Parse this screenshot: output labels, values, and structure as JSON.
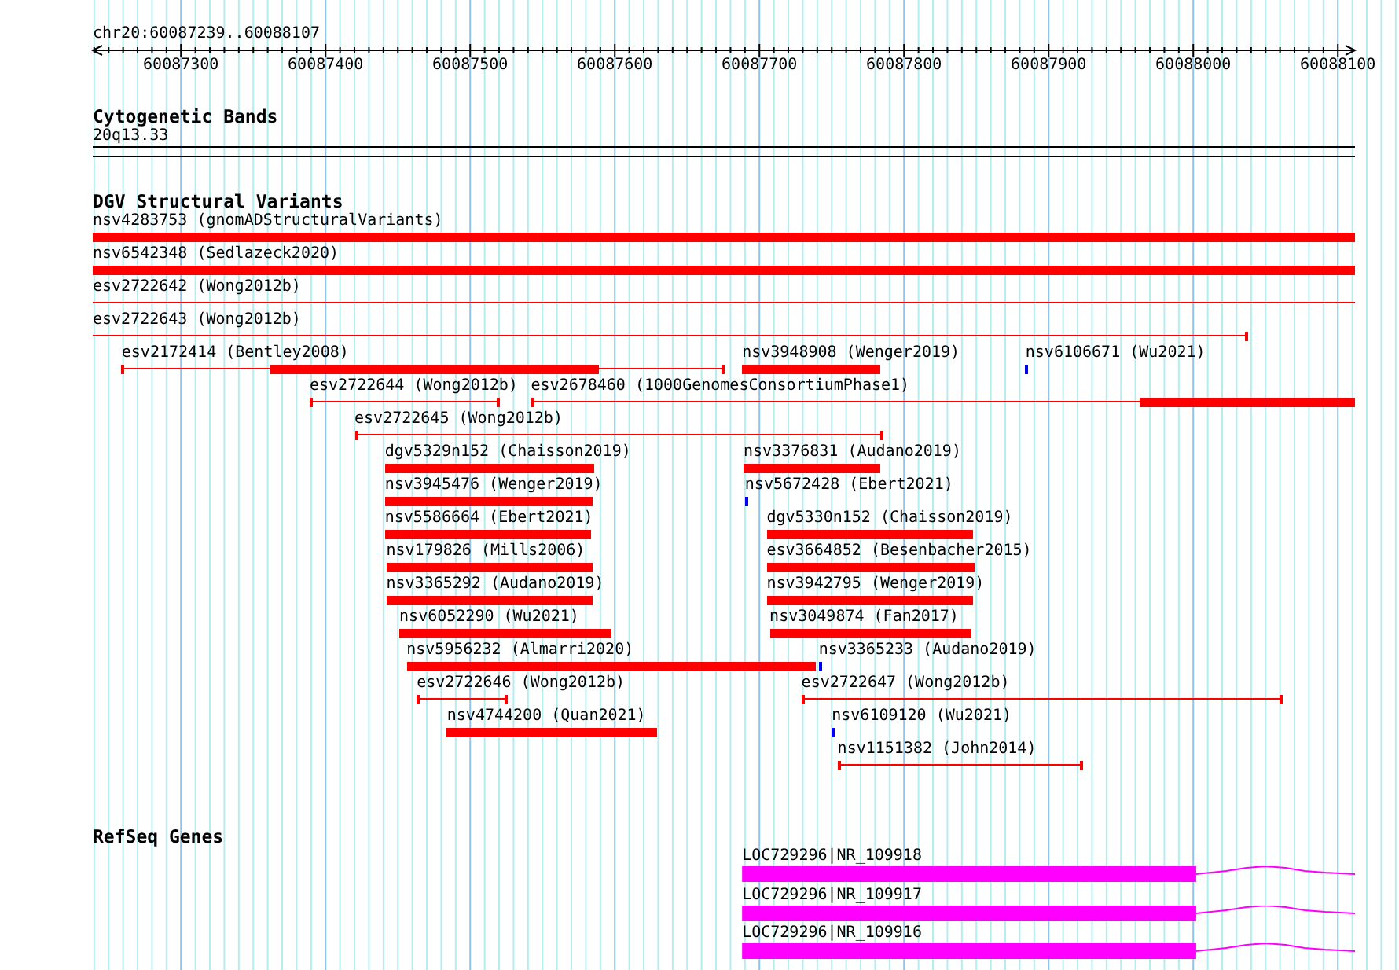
{
  "ruler": {
    "location": "chr20:60087239..60088107",
    "ticks": [
      "60087300",
      "60087400",
      "60087500",
      "60087600",
      "60087700",
      "60087800",
      "60087900",
      "60088000",
      "60088100"
    ]
  },
  "tracks": [
    {
      "kind": "cytoband",
      "title": "Cytogenetic Bands",
      "band": "20q13.33"
    },
    {
      "kind": "variants",
      "title": "DGV Structural Variants",
      "features": [
        {
          "label": "nsv4283753 (gnomADStructuralVariants)",
          "kind": "bar",
          "color": "#ff0000"
        },
        {
          "label": "nsv6542348 (Sedlazeck2020)",
          "kind": "bar",
          "color": "#ff0000"
        },
        {
          "label": "esv2722642 (Wong2012b)",
          "kind": "span",
          "color": "#ff0000"
        },
        {
          "label": "esv2722643 (Wong2012b)",
          "kind": "span",
          "color": "#ff0000"
        },
        {
          "label": "esv2172414 (Bentley2008)",
          "kind": "span",
          "color": "#ff0000"
        },
        {
          "label": "nsv3948908 (Wenger2019)",
          "kind": "bar",
          "color": "#ff0000"
        },
        {
          "label": "nsv6106671 (Wu2021)",
          "kind": "point",
          "color": "#0000ff"
        },
        {
          "label": "esv2722644 (Wong2012b)",
          "kind": "span",
          "color": "#ff0000"
        },
        {
          "label": "esv2678460 (1000GenomesConsortiumPhase1)",
          "kind": "span",
          "color": "#ff0000"
        },
        {
          "label": "esv2722645 (Wong2012b)",
          "kind": "span",
          "color": "#ff0000"
        },
        {
          "label": "dgv5329n152 (Chaisson2019)",
          "kind": "bar",
          "color": "#ff0000"
        },
        {
          "label": "nsv3376831 (Audano2019)",
          "kind": "bar",
          "color": "#ff0000"
        },
        {
          "label": "nsv3945476 (Wenger2019)",
          "kind": "bar",
          "color": "#ff0000"
        },
        {
          "label": "nsv5672428 (Ebert2021)",
          "kind": "point",
          "color": "#0000ff"
        },
        {
          "label": "nsv5586664 (Ebert2021)",
          "kind": "bar",
          "color": "#ff0000"
        },
        {
          "label": "dgv5330n152 (Chaisson2019)",
          "kind": "bar",
          "color": "#ff0000"
        },
        {
          "label": "nsv179826 (Mills2006)",
          "kind": "bar",
          "color": "#ff0000"
        },
        {
          "label": "esv3664852 (Besenbacher2015)",
          "kind": "bar",
          "color": "#ff0000"
        },
        {
          "label": "nsv3365292 (Audano2019)",
          "kind": "bar",
          "color": "#ff0000"
        },
        {
          "label": "nsv3942795 (Wenger2019)",
          "kind": "bar",
          "color": "#ff0000"
        },
        {
          "label": "nsv6052290 (Wu2021)",
          "kind": "bar",
          "color": "#ff0000"
        },
        {
          "label": "nsv3049874 (Fan2017)",
          "kind": "bar",
          "color": "#ff0000"
        },
        {
          "label": "nsv5956232 (Almarri2020)",
          "kind": "bar",
          "color": "#ff0000"
        },
        {
          "label": "nsv3365233 (Audano2019)",
          "kind": "point",
          "color": "#0000ff"
        },
        {
          "label": "esv2722646 (Wong2012b)",
          "kind": "span",
          "color": "#ff0000"
        },
        {
          "label": "esv2722647 (Wong2012b)",
          "kind": "span",
          "color": "#ff0000"
        },
        {
          "label": "nsv4744200 (Quan2021)",
          "kind": "bar",
          "color": "#ff0000"
        },
        {
          "label": "nsv6109120 (Wu2021)",
          "kind": "point",
          "color": "#0000ff"
        },
        {
          "label": "nsv1151382 (John2014)",
          "kind": "span",
          "color": "#ff0000"
        }
      ]
    },
    {
      "kind": "genes",
      "title": "RefSeq Genes",
      "genes": [
        {
          "label": "LOC729296|NR_109918"
        },
        {
          "label": "LOC729296|NR_109917"
        },
        {
          "label": "LOC729296|NR_109916"
        }
      ]
    }
  ]
}
